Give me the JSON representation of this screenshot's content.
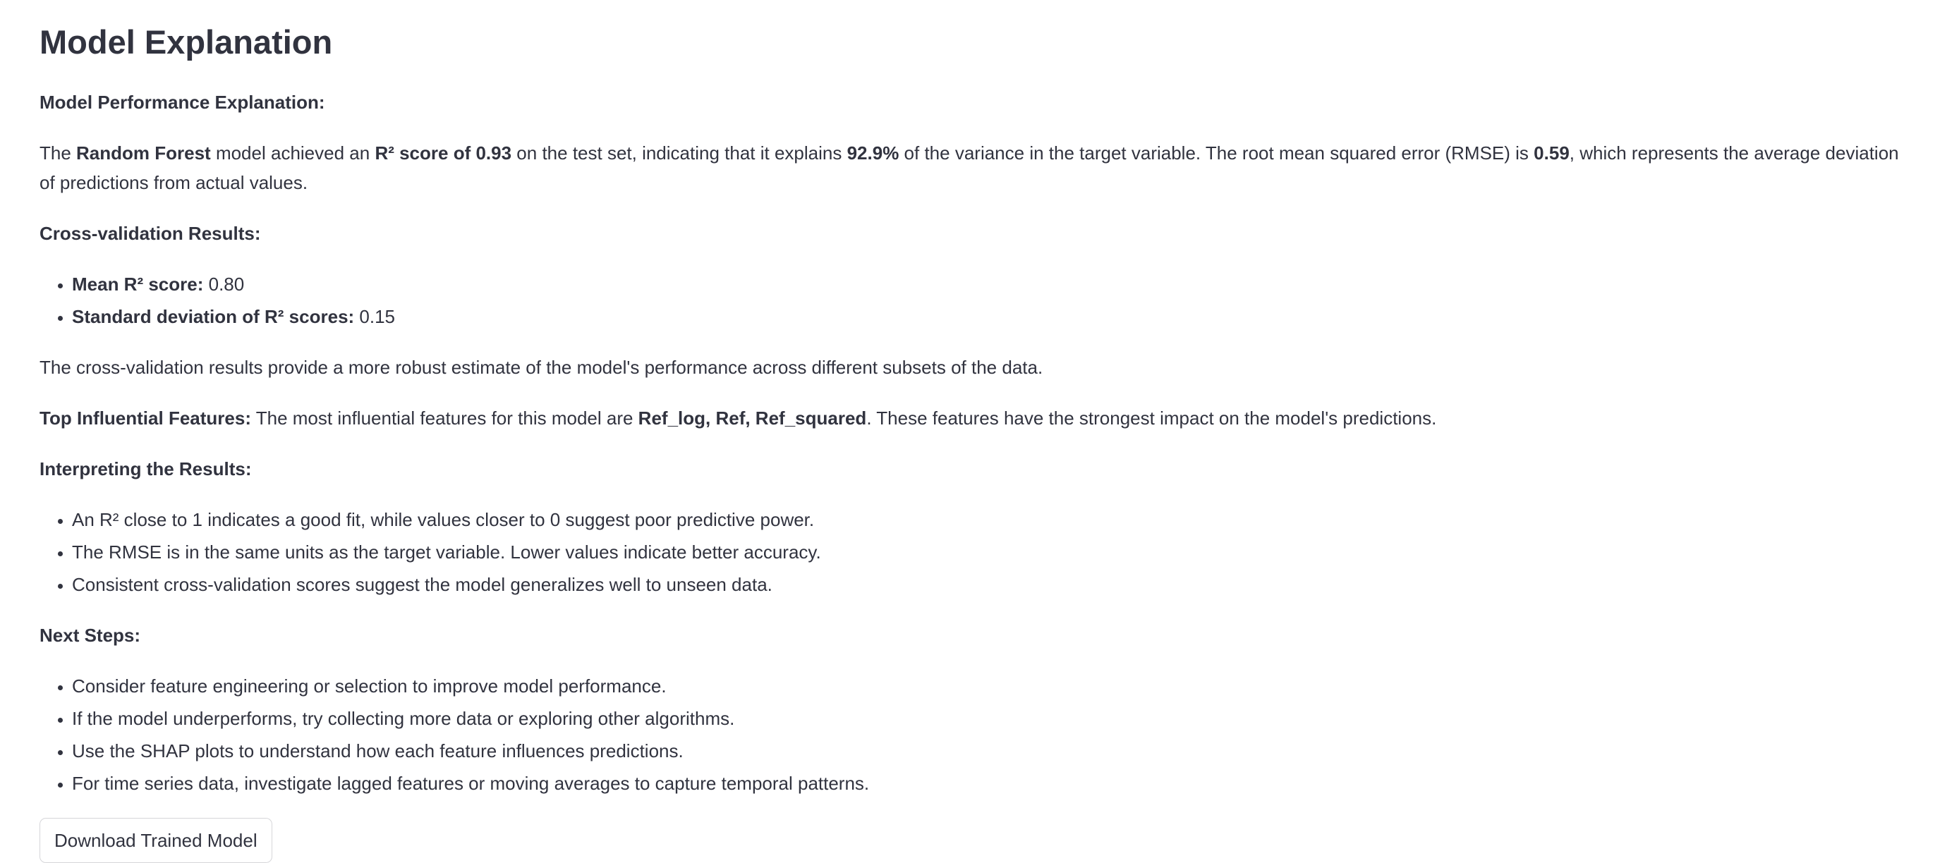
{
  "title": "Model Explanation",
  "performance": {
    "heading": "Model Performance Explanation:",
    "t1": "The ",
    "model_name": "Random Forest",
    "t2": " model achieved an ",
    "r2_phrase": "R² score of 0.93",
    "t3": " on the test set, indicating that it explains ",
    "variance_pct": "92.9%",
    "t4": " of the variance in the target variable. The root mean squared error (RMSE) is ",
    "rmse": "0.59",
    "t5": ", which represents the average deviation of predictions from actual values."
  },
  "cross_validation": {
    "heading": "Cross-validation Results:",
    "items": [
      {
        "label": "Mean R² score:",
        "value": " 0.80"
      },
      {
        "label": "Standard deviation of R² scores:",
        "value": " 0.15"
      }
    ],
    "note": "The cross-validation results provide a more robust estimate of the model's performance across different subsets of the data."
  },
  "features": {
    "label": "Top Influential Features:",
    "t1": " The most influential features for this model are ",
    "list": "Ref_log, Ref, Ref_squared",
    "t2": ". These features have the strongest impact on the model's predictions."
  },
  "interpreting": {
    "heading": "Interpreting the Results:",
    "items": [
      "An R² close to 1 indicates a good fit, while values closer to 0 suggest poor predictive power.",
      "The RMSE is in the same units as the target variable. Lower values indicate better accuracy.",
      "Consistent cross-validation scores suggest the model generalizes well to unseen data."
    ]
  },
  "next_steps": {
    "heading": "Next Steps:",
    "items": [
      "Consider feature engineering or selection to improve model performance.",
      "If the model underperforms, try collecting more data or exploring other algorithms.",
      "Use the SHAP plots to understand how each feature influences predictions.",
      "For time series data, investigate lagged features or moving averages to capture temporal patterns."
    ]
  },
  "download_button": "Download Trained Model"
}
